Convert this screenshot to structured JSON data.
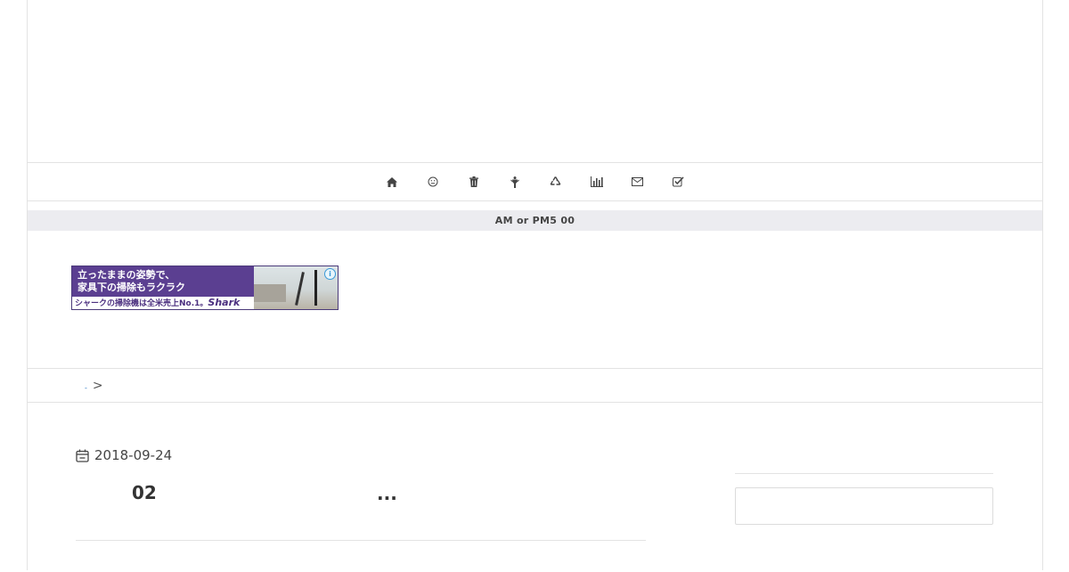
{
  "nav": {
    "items": [
      {
        "icon": "home-icon"
      },
      {
        "icon": "smiley-icon"
      },
      {
        "icon": "trash-icon"
      },
      {
        "icon": "person-icon"
      },
      {
        "icon": "recycle-icon"
      },
      {
        "icon": "bar-chart-icon"
      },
      {
        "icon": "envelope-icon"
      },
      {
        "icon": "check-square-icon"
      }
    ]
  },
  "notice": {
    "text": "AM or PM5  00"
  },
  "ad": {
    "line1": "立ったままの姿勢で、",
    "line2": "家具下の掃除もラクラク",
    "footer": "シャークの掃除機は全米売上No.1。",
    "brand": "Shark",
    "info": "i"
  },
  "breadcrumb": {
    "link": "-",
    "separator": ">"
  },
  "post": {
    "date": "2018-09-24",
    "title": "02",
    "ellipsis": "..."
  }
}
